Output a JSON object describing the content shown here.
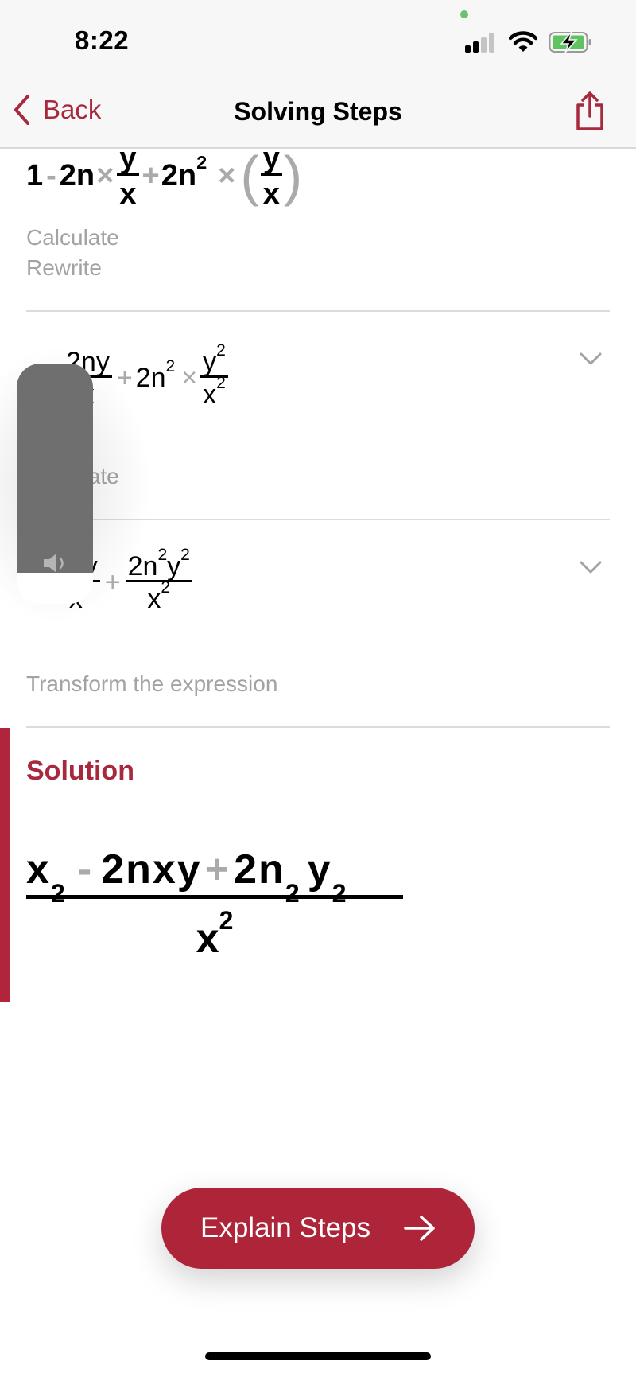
{
  "status_bar": {
    "time": "8:22",
    "signal_bars_filled": 2,
    "signal_bars_total": 4,
    "battery_state": "charging",
    "colors": {
      "battery": "#5fc35f",
      "camera_dot": "#6cc36f"
    }
  },
  "nav": {
    "back_label": "Back",
    "title": "Solving Steps",
    "share_icon": "share-icon"
  },
  "steps": [
    {
      "expression": "1 - 2n × y/x + 2n² × (y/x)²",
      "parts": {
        "a": "1",
        "minus": "-",
        "b": "2n",
        "times": "×",
        "fy": "y",
        "fx": "x",
        "plus": "+",
        "c": "2n",
        "exp": "2",
        "times2": "×",
        "py": "y",
        "px": "x"
      },
      "descriptions": [
        "Calculate",
        "Rewrite"
      ],
      "expanded": true
    },
    {
      "expression": "1 - 2ny/x + 2n² × y²/x²",
      "parts": {
        "num1": "2ny",
        "den1": "x",
        "plus": "+",
        "c": "2n",
        "exp": "2",
        "times": "×",
        "num2": "y",
        "den2": "x"
      },
      "descriptions": [
        "Calculate"
      ],
      "expanded": false
    },
    {
      "expression": "1 - 2ny/x + 2n²y²/x²",
      "parts": {
        "lead": "1",
        "num1": "2ny",
        "den1": "x",
        "plus": "+",
        "num2a": "2n",
        "num2b": "y",
        "exp": "2",
        "den2": "x"
      },
      "descriptions": [
        "Transform the expression"
      ],
      "expanded": false
    }
  ],
  "solution": {
    "label": "Solution",
    "expression": "(x² - 2nxy + 2n²y²) / x²",
    "parts": {
      "x": "x",
      "exp": "2",
      "minus": "-",
      "mid": "2nxy",
      "plus": "+",
      "c": "2n",
      "y": "y",
      "den": "x"
    }
  },
  "hud": {
    "type": "volume",
    "level": 0.87,
    "icon": "speaker-icon"
  },
  "explain_button": {
    "label": "Explain Steps",
    "icon": "arrow-right-icon"
  },
  "colors": {
    "accent": "#ae2539",
    "muted_text": "#a3a3a3",
    "divider": "#dcdcdc",
    "nav_bg": "#f7f7f7"
  }
}
